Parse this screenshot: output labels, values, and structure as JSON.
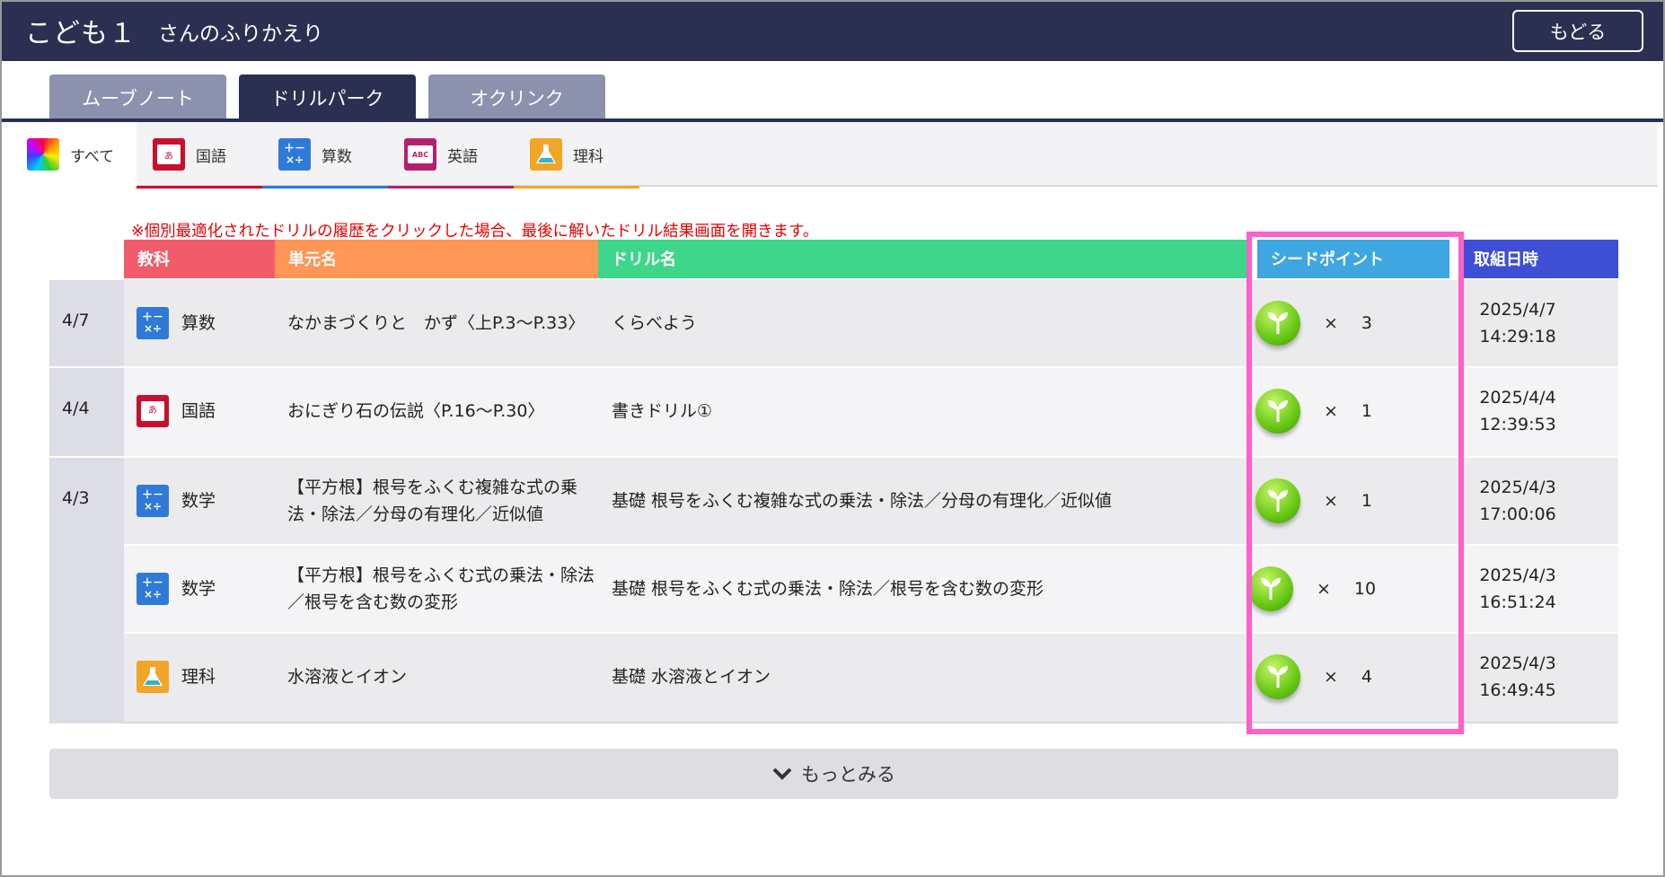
{
  "header": {
    "child_name": "こども１",
    "title_suffix": "さんのふりかえり",
    "back_label": "もどる"
  },
  "main_tabs": [
    {
      "label": "ムーブノート",
      "active": false
    },
    {
      "label": "ドリルパーク",
      "active": true
    },
    {
      "label": "オクリンク",
      "active": false
    }
  ],
  "subject_tabs": [
    {
      "label": "すべて",
      "icon": "rainbow-icon",
      "color": "#ffffff",
      "active": true
    },
    {
      "label": "国語",
      "icon": "japanese-book-icon",
      "color": "#c8102e",
      "active": false
    },
    {
      "label": "算数",
      "icon": "math-operators-icon",
      "color": "#2e7ad6",
      "active": false
    },
    {
      "label": "英語",
      "icon": "english-abc-icon",
      "color": "#b5206c",
      "active": false
    },
    {
      "label": "理科",
      "icon": "science-flask-icon",
      "color": "#f2a526",
      "active": false
    }
  ],
  "notice": "※個別最適化されたドリルの履歴をクリックした場合、最後に解いたドリル結果画面を開きます。",
  "table": {
    "headers": {
      "subject": "教科",
      "unit": "単元名",
      "drill": "ドリル名",
      "seed": "シードポイント",
      "time": "取組日時"
    },
    "header_colors": {
      "subject": "#f25c6a",
      "unit": "#ff9655",
      "drill": "#3ed68a",
      "seed": "#3ea6e0",
      "time": "#3e4fd6"
    },
    "dates": [
      "4/7",
      "4/4",
      "4/3"
    ],
    "rows": [
      {
        "subject": "算数",
        "icon": "math-operators-icon",
        "unit": "なかまづくりと　かず〈上P.3～P.33〉",
        "drill": "くらべよう",
        "multiplier": "×",
        "seeds": "3",
        "date": "2025/4/7",
        "time": "14:29:18"
      },
      {
        "subject": "国語",
        "icon": "japanese-book-icon",
        "unit": "おにぎり石の伝説〈P.16～P.30〉",
        "drill": "書きドリル①",
        "multiplier": "×",
        "seeds": "1",
        "date": "2025/4/4",
        "time": "12:39:53"
      },
      {
        "subject": "数学",
        "icon": "math-operators-icon",
        "unit": "【平方根】根号をふくむ複雑な式の乗法・除法／分母の有理化／近似値",
        "drill": "基礎 根号をふくむ複雑な式の乗法・除法／分母の有理化／近似値",
        "multiplier": "×",
        "seeds": "1",
        "date": "2025/4/3",
        "time": "17:00:06"
      },
      {
        "subject": "数学",
        "icon": "math-operators-icon",
        "unit": "【平方根】根号をふくむ式の乗法・除法／根号を含む数の変形",
        "drill": "基礎 根号をふくむ式の乗法・除法／根号を含む数の変形",
        "multiplier": "×",
        "seeds": "10",
        "date": "2025/4/3",
        "time": "16:51:24"
      },
      {
        "subject": "理科",
        "icon": "science-flask-icon",
        "unit": "水溶液とイオン",
        "drill": "基礎 水溶液とイオン",
        "multiplier": "×",
        "seeds": "4",
        "date": "2025/4/3",
        "time": "16:49:45"
      }
    ]
  },
  "more_label": "もっとみる",
  "colors": {
    "header_bg": "#2b3053",
    "highlight": "#ff5fc8",
    "notice": "#e60000"
  }
}
